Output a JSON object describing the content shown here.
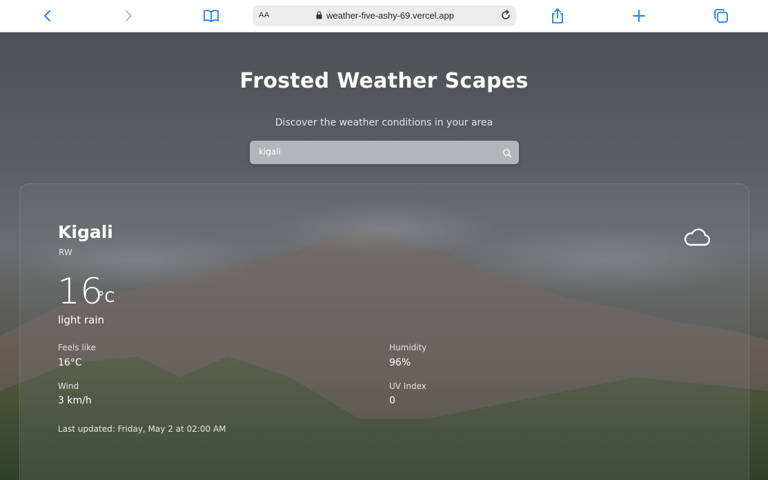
{
  "browser": {
    "font_size_label": "AA",
    "url": "weather-five-ashy-69.vercel.app",
    "icons": {
      "back": "chevron-left-icon",
      "forward": "chevron-right-icon",
      "bookmarks": "book-icon",
      "lock": "lock-icon",
      "reload": "reload-icon",
      "share": "share-icon",
      "new_tab": "plus-icon",
      "tabs": "tabs-icon"
    }
  },
  "header": {
    "title": "Frosted Weather Scapes",
    "subtitle": "Discover the weather conditions in your area"
  },
  "search": {
    "value": "kigali",
    "icon": "search-icon"
  },
  "weather": {
    "city": "Kigali",
    "country": "RW",
    "temperature": "16",
    "unit": "°C",
    "condition": "light rain",
    "condition_icon": "cloud-icon",
    "details": {
      "feels_like_label": "Feels like",
      "feels_like_value": "16°C",
      "humidity_label": "Humidity",
      "humidity_value": "96%",
      "wind_label": "Wind",
      "wind_value": "3 km/h",
      "uv_label": "UV Index",
      "uv_value": "0"
    },
    "last_updated": "Last updated: Friday, May 2 at 02:00 AM"
  },
  "colors": {
    "accent": "#1a7cf2",
    "text": "#ffffff"
  }
}
